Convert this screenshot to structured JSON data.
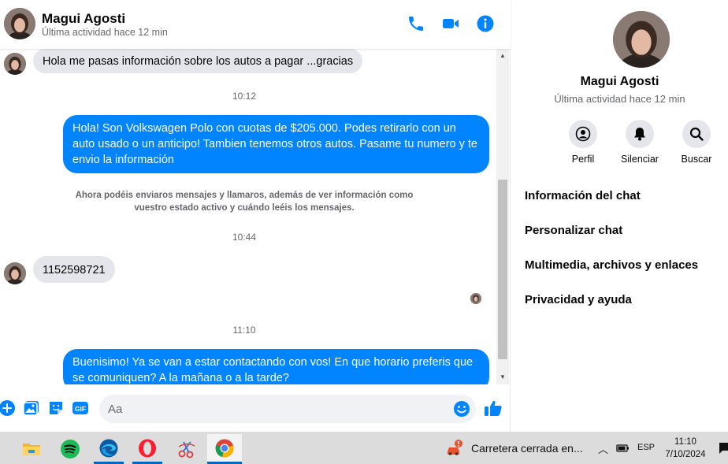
{
  "contact": {
    "name": "Magui Agosti",
    "status": "Última actividad hace 12 min"
  },
  "messages": {
    "m1": "Hola me pasas información sobre los autos a pagar ...gracias",
    "t1": "10:12",
    "m2": "Hola! Son Volkswagen Polo con cuotas de $205.000. Podes retirarlo con un auto usado o un anticipo! Tambien tenemos otros autos. Pasame tu numero y te envio la información",
    "system_note": "Ahora podéis enviaros mensajes y llamaros, además de ver información como vuestro estado activo y cuándo leéis los mensajes.",
    "t2": "10:44",
    "m3": "1152598721",
    "t3": "11:10",
    "m4": "Buenisimo! Ya se van a estar contactando con vos! En que horario preferis que se comuniquen? A la mañana o a la tarde?"
  },
  "composer": {
    "placeholder": "Aa",
    "gif_label": "GIF"
  },
  "info_panel": {
    "actions": [
      "Perfil",
      "Silenciar",
      "Buscar"
    ],
    "menu": [
      "Información del chat",
      "Personalizar chat",
      "Multimedia, archivos y enlaces",
      "Privacidad y ayuda"
    ]
  },
  "taskbar": {
    "weather_text": "Carretera cerrada en...",
    "language": "ESP",
    "time": "11:10",
    "date": "7/10/2024"
  },
  "colors": {
    "accent": "#0084ff",
    "incoming_bubble": "#e4e6eb",
    "muted_text": "#65676b"
  }
}
